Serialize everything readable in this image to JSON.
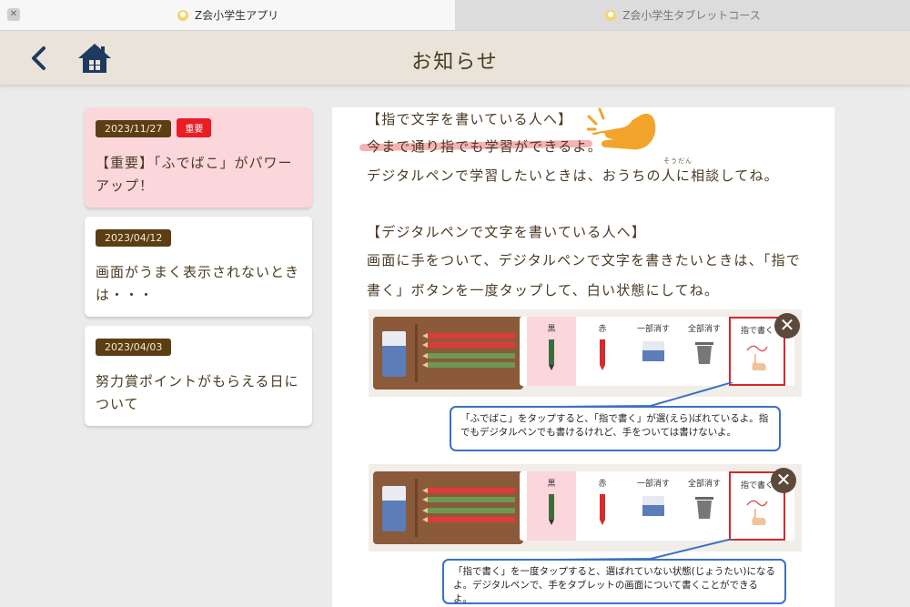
{
  "tabs": [
    {
      "label": "Z会小学生アプリ",
      "active": true
    },
    {
      "label": "Z会小学生タブレットコース",
      "active": false
    }
  ],
  "tab_close_label": "✕",
  "header": {
    "title": "お知らせ"
  },
  "notices": [
    {
      "date": "2023/11/27",
      "badge": "重要",
      "title": "【重要】「ふでばこ」がパワーアップ！",
      "selected": true
    },
    {
      "date": "2023/04/12",
      "title": "画面がうまく表示されないときは・・・",
      "selected": false
    },
    {
      "date": "2023/04/03",
      "title": "努力賞ポイントがもらえる日について",
      "selected": false
    }
  ],
  "content": {
    "heading1": "【指で文字を書いている人へ】",
    "line1": "今まで通り指でも学習ができるよ。",
    "line2": "デジタルペンで学習したいときは、おうちの人に相談してね。",
    "ruby": "そうだん",
    "heading2": "【デジタルペンで文字を書いている人へ】",
    "line3": "画面に手をついて、デジタルペンで文字を書きたいときは、「指で",
    "line4": "書く」ボタンを一度タップして、白い状態にしてね。",
    "tools": [
      "黒",
      "赤",
      "一部消す",
      "全部消す",
      "指で書く"
    ],
    "close_symbol": "✕",
    "callout1_line1": "「ふでばこ」をタップすると、「指で書く」が選(えら)ばれているよ。指",
    "callout1_line2": "でもデジタルペンでも書けるけれど、手をついては書けないよ。",
    "callout2_line1": "「指で書く」を一度タップすると、選ばれていない状態(じょうたい)になる",
    "callout2_line2": "よ。デジタルペンで、手をタブレットの画面について書くことができるよ。"
  },
  "colors": {
    "header_bg": "#e9e3da",
    "date_badge": "#5b3e12",
    "important_badge": "#ea1c24",
    "selected_notice": "#fbd7dc",
    "callout_border": "#3b70c4",
    "icon_navy": "#1e3a5f"
  },
  "icons": {
    "back": "chevron-left-icon",
    "home": "home-icon",
    "tab": "app-logo-icon",
    "hint": "pointing-hand-icon"
  }
}
